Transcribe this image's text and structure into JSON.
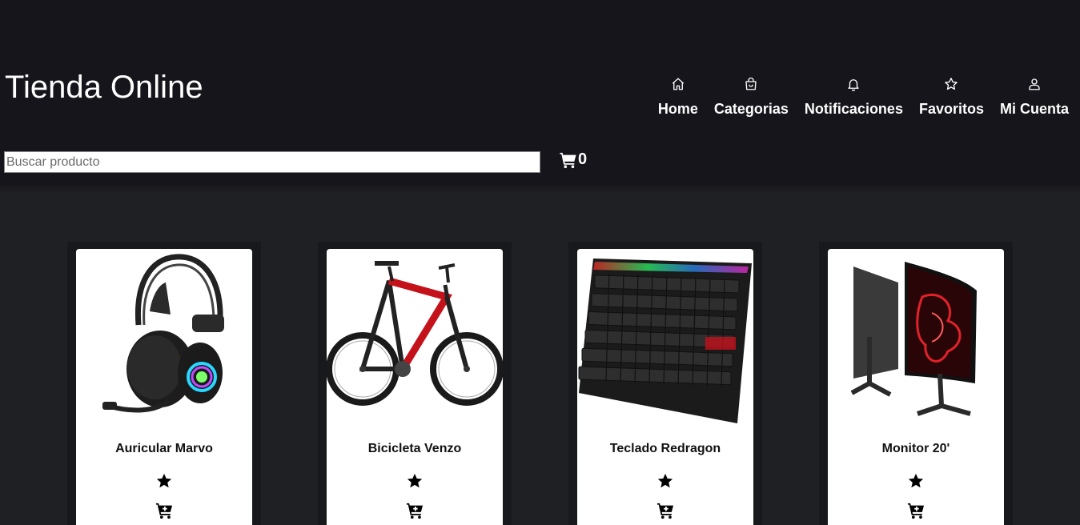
{
  "header": {
    "title": "Tienda Online",
    "nav": [
      {
        "label": "Home",
        "icon": "home-icon"
      },
      {
        "label": "Categorias",
        "icon": "shopping-bag-icon"
      },
      {
        "label": "Notificaciones",
        "icon": "bell-icon"
      },
      {
        "label": "Favoritos",
        "icon": "star-icon"
      },
      {
        "label": "Mi Cuenta",
        "icon": "user-icon"
      }
    ],
    "search": {
      "placeholder": "Buscar producto",
      "value": ""
    },
    "cart": {
      "icon": "cart-icon",
      "count": "0"
    }
  },
  "products": [
    {
      "name": "Auricular Marvo",
      "image": "headset-image"
    },
    {
      "name": "Bicicleta Venzo",
      "image": "bicycle-image"
    },
    {
      "name": "Teclado Redragon",
      "image": "keyboard-image"
    },
    {
      "name": "Monitor 20'",
      "image": "monitor-image"
    }
  ],
  "colors": {
    "header_bg": "#15151b",
    "page_bg": "#1f2024",
    "card_bg": "#ffffff",
    "text_light": "#ffffff",
    "text_dark": "#111111"
  }
}
